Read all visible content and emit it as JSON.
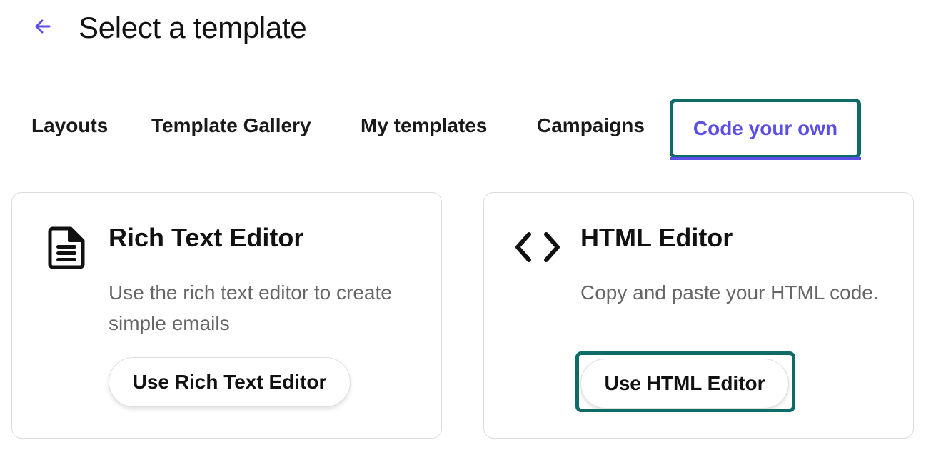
{
  "header": {
    "title": "Select a template",
    "back_icon": "arrow-left-icon"
  },
  "tabs": [
    {
      "label": "Layouts",
      "active": false
    },
    {
      "label": "Template Gallery",
      "active": false
    },
    {
      "label": "My templates",
      "active": false
    },
    {
      "label": "Campaigns",
      "active": false
    },
    {
      "label": "Code your own",
      "active": true
    }
  ],
  "cards": [
    {
      "icon": "document-icon",
      "title": "Rich Text Editor",
      "description": "Use the rich text editor to create simple emails",
      "button_label": "Use Rich Text Editor"
    },
    {
      "icon": "code-brackets-icon",
      "title": "HTML Editor",
      "description": "Copy and paste your HTML code.",
      "button_label": "Use HTML Editor"
    }
  ],
  "colors": {
    "accent": "#5b4de6",
    "highlight": "#0d6b68",
    "text": "#111111",
    "muted_text": "#666666"
  }
}
